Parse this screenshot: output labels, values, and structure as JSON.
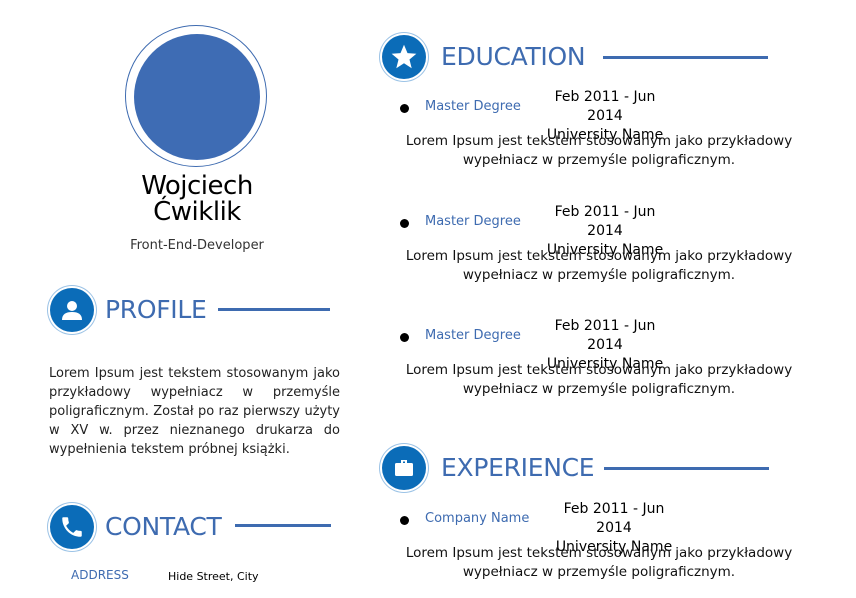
{
  "profile": {
    "first_name": "Wojciech",
    "last_name": "Ćwiklik",
    "role": "Front-End-Developer"
  },
  "sections": {
    "profile": {
      "title": "PROFILE",
      "icon": "user-icon",
      "text": "Lorem Ipsum jest tekstem stosowanym jako przykładowy wypełniacz w przemyśle poligraficznym. Został po raz pierwszy użyty w XV w. przez nieznanego drukarza do wypełnienia tekstem próbnej książki."
    },
    "contact": {
      "title": "CONTACT",
      "icon": "phone-icon",
      "address_label": "ADDRESS",
      "address_value": "Hide Street, City"
    },
    "education": {
      "title": "EDUCATION",
      "icon": "star-icon",
      "items": [
        {
          "label": "Master Degree",
          "dates": "Feb 2011 - Jun 2014",
          "place": "University Name",
          "desc1": "Lorem Ipsum jest tekstem stosowanym jako przykładowy",
          "desc2": "wypełniacz w przemyśle poligraficznym."
        },
        {
          "label": "Master Degree",
          "dates": "Feb 2011 - Jun 2014",
          "place": "University Name",
          "desc1": "Lorem Ipsum jest tekstem stosowanym jako przykładowy",
          "desc2": "wypełniacz w przemyśle poligraficznym."
        },
        {
          "label": "Master Degree",
          "dates": "Feb 2011 - Jun 2014",
          "place": "University Name",
          "desc1": "Lorem Ipsum jest tekstem stosowanym jako przykładowy",
          "desc2": "wypełniacz w przemyśle poligraficznym."
        }
      ]
    },
    "experience": {
      "title": "EXPERIENCE",
      "icon": "briefcase-icon",
      "items": [
        {
          "label": "Company Name",
          "dates": "Feb 2011 - Jun 2014",
          "place": "University Name",
          "desc1": "Lorem Ipsum jest tekstem stosowanym jako przykładowy",
          "desc2": "wypełniacz w przemyśle poligraficznym."
        }
      ]
    }
  },
  "colors": {
    "accent": "#3e6bb0",
    "icon_bg": "#0b6cb8"
  }
}
